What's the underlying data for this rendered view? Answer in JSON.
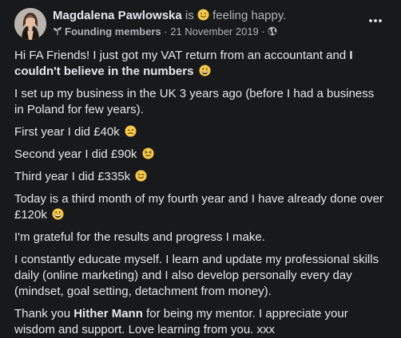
{
  "post": {
    "author_name": "Magdalena Pawlowska",
    "status_prefix": "is",
    "status_text": "feeling happy.",
    "status_emoji_icon": "slightly-smiling-face-icon",
    "group_badge_icon": "sprout-icon",
    "group_name": "Founding members",
    "separator": "·",
    "date": "21 November 2019",
    "audience_icon": "globe-icon",
    "more_options_icon": "ellipsis-icon",
    "paragraphs": [
      {
        "segments": [
          {
            "text": "Hi FA Friends! I just got my VAT return from an accountant and "
          },
          {
            "text": "I couldn't believe in the numbers",
            "bold": true
          }
        ],
        "emoji": "grinning-face-icon"
      },
      {
        "segments": [
          {
            "text": "I set up my business in the UK 3 years ago (before I had a business in Poland for few years)."
          }
        ]
      },
      {
        "segments": [
          {
            "text": "First year I did £40k"
          }
        ],
        "emoji": "frowning-face-icon"
      },
      {
        "segments": [
          {
            "text": "Second year I did £90k"
          }
        ],
        "emoji": "confounded-face-icon"
      },
      {
        "segments": [
          {
            "text": "Third year I did £335k"
          }
        ],
        "emoji": "smiling-face-icon"
      },
      {
        "segments": [
          {
            "text": "Today is a third month of my fourth year and I have already done over £120k"
          }
        ],
        "emoji": "grinning-face-icon"
      },
      {
        "segments": [
          {
            "text": "I'm grateful for the results and progress I make."
          }
        ]
      },
      {
        "segments": [
          {
            "text": "I constantly educate myself. I learn and update my professional skills daily (online marketing) and I also develop personally every day (mindset, goal setting, detachment from money)."
          }
        ]
      },
      {
        "segments": [
          {
            "text": "Thank you "
          },
          {
            "text": "Hither Mann",
            "bold": true
          },
          {
            "text": " for being my mentor. I appreciate your wisdom and support. Love learning from you. xxx"
          }
        ]
      }
    ]
  },
  "colors": {
    "background": "#18191a",
    "primary_text": "#e4e6eb",
    "secondary_text": "#b0b3b8",
    "emoji_yellow": "#f7c948"
  }
}
